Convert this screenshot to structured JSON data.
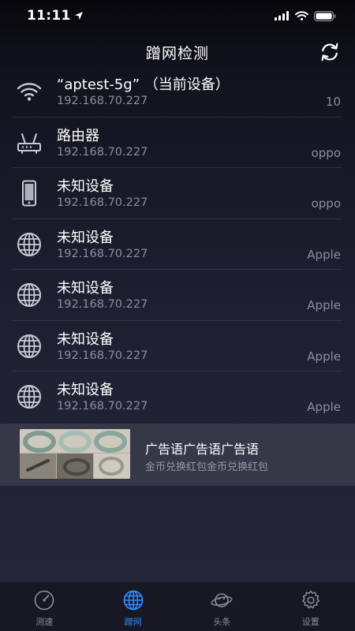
{
  "status_bar": {
    "time": "11:11"
  },
  "header": {
    "title": "蹭网检测"
  },
  "devices": [
    {
      "icon": "wifi-icon",
      "name": "“aptest-5g” （当前设备）",
      "ip": "192.168.70.227",
      "vendor": "10"
    },
    {
      "icon": "router-icon",
      "name": "路由器",
      "ip": "192.168.70.227",
      "vendor": "oppo"
    },
    {
      "icon": "phone-icon",
      "name": "未知设备",
      "ip": "192.168.70.227",
      "vendor": "oppo"
    },
    {
      "icon": "globe-icon",
      "name": "未知设备",
      "ip": "192.168.70.227",
      "vendor": "Apple"
    },
    {
      "icon": "globe-icon",
      "name": "未知设备",
      "ip": "192.168.70.227",
      "vendor": "Apple"
    },
    {
      "icon": "globe-icon",
      "name": "未知设备",
      "ip": "192.168.70.227",
      "vendor": "Apple"
    },
    {
      "icon": "globe-icon",
      "name": "未知设备",
      "ip": "192.168.70.227",
      "vendor": "Apple"
    }
  ],
  "ad": {
    "title": "广告语广告语广告语",
    "subtitle": "金币兑换红包金币兑换红包"
  },
  "tabs": [
    {
      "label": "测速",
      "icon": "speedometer-icon",
      "active": false
    },
    {
      "label": "蹭网",
      "icon": "globe-icon",
      "active": true
    },
    {
      "label": "头条",
      "icon": "planet-icon",
      "active": false
    },
    {
      "label": "设置",
      "icon": "gear-icon",
      "active": false
    }
  ],
  "colors": {
    "accent": "#2f8dff",
    "muted_text": "#8c8e9c",
    "ad_background": "#363848",
    "tab_bar": "#171824"
  }
}
